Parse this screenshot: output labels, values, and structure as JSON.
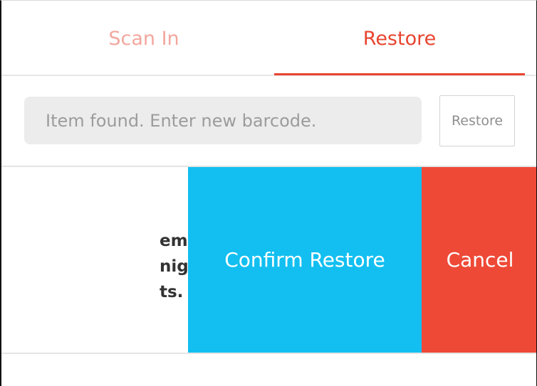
{
  "tabs": [
    {
      "label": "Scan In",
      "active": false
    },
    {
      "label": "Restore",
      "active": true
    }
  ],
  "barcode": {
    "placeholder": "Item found. Enter new barcode.",
    "value": "",
    "button_label": "Restore"
  },
  "row": {
    "text_lines": [
      "em,",
      "night",
      "ts."
    ]
  },
  "actions": {
    "confirm_label": "Confirm Restore",
    "cancel_label": "Cancel"
  },
  "colors": {
    "accent": "#e8442f",
    "inactive_tab": "#f2a79e",
    "confirm": "#12bff0",
    "cancel": "#ee4937"
  }
}
